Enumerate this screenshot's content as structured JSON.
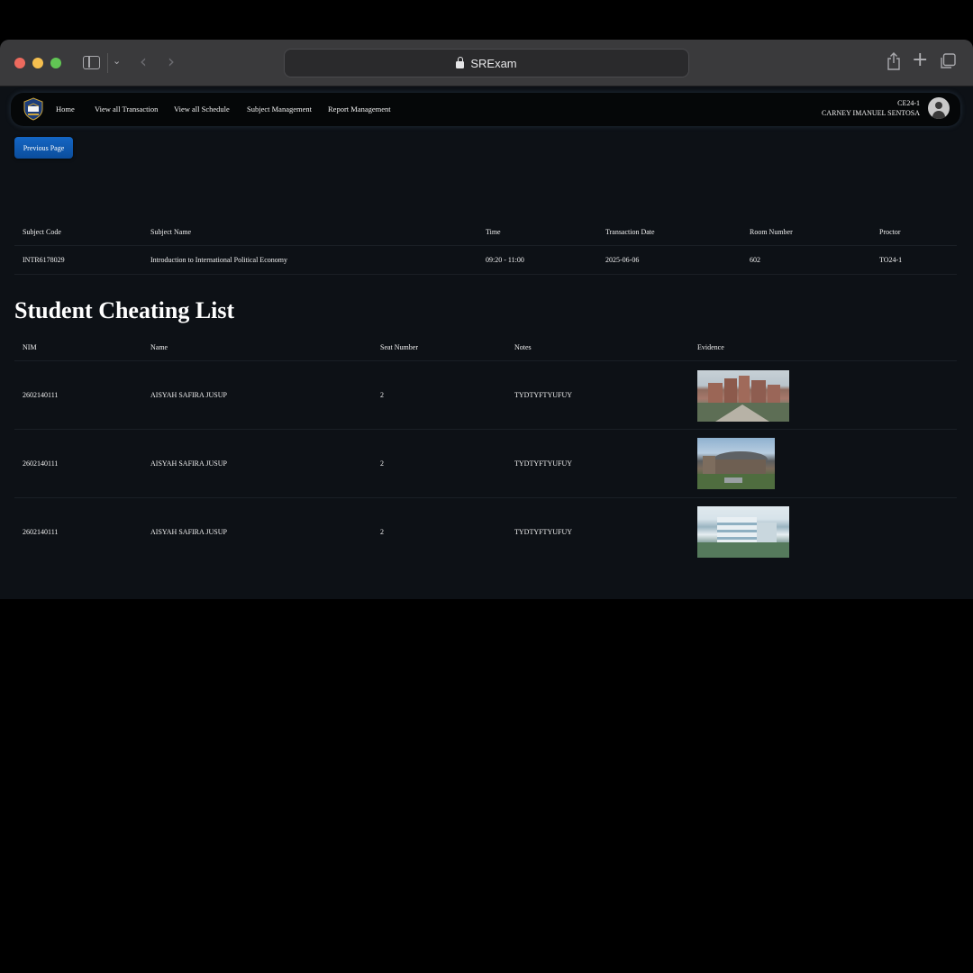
{
  "browser": {
    "url_title": "SRExam"
  },
  "navbar": {
    "links": [
      "Home",
      "View all Transaction",
      "View all Schedule",
      "Subject Management",
      "Report Management"
    ],
    "user_code": "CE24-1",
    "user_name": "CARNEY IMANUEL SENTOSA"
  },
  "actions": {
    "previous_page": "Previous Page"
  },
  "transaction_table": {
    "headers": [
      "Subject Code",
      "Subject Name",
      "Time",
      "Transaction Date",
      "Room Number",
      "Proctor"
    ],
    "row": [
      "INTR6178029",
      "Introduction to International Political Economy",
      "09:20 - 11:00",
      "2025-06-06",
      "602",
      "TO24-1"
    ]
  },
  "cheating_list": {
    "title": "Student Cheating List",
    "headers": [
      "NIM",
      "Name",
      "Seat Number",
      "Notes",
      "Evidence"
    ],
    "rows": [
      {
        "nim": "2602140111",
        "name": "AISYAH SAFIRA JUSUP",
        "seat": "2",
        "notes": "TYDTYFTYUFUY",
        "evidence": "campus-building-photo"
      },
      {
        "nim": "2602140111",
        "name": "AISYAH SAFIRA JUSUP",
        "seat": "2",
        "notes": "TYDTYFTYUFUY",
        "evidence": "campus-building-photo"
      },
      {
        "nim": "2602140111",
        "name": "AISYAH SAFIRA JUSUP",
        "seat": "2",
        "notes": "TYDTYFTYUFUY",
        "evidence": "campus-building-photo"
      }
    ]
  }
}
